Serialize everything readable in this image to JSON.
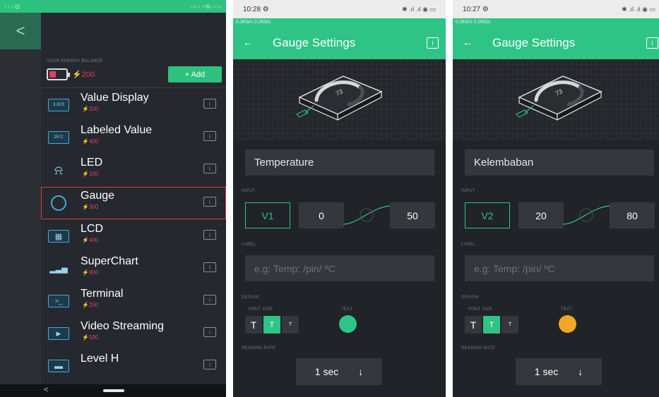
{
  "panel1": {
    "status_left": "◦ ◦ ◦  ⊡",
    "status_right": "◦◦◦ ◦ ◦◦%  ◦◦:◦◦",
    "back": "<",
    "balance_label": "YOUR ENERGY BALANCE",
    "balance": "200",
    "add_label": "+ Add",
    "items": [
      {
        "name": "Value Display",
        "cost": "200",
        "icon": "value-display-icon",
        "glyph": "3.3V3"
      },
      {
        "name": "Labeled Value",
        "cost": "400",
        "icon": "labeled-value-icon",
        "glyph": "25°C"
      },
      {
        "name": "LED",
        "cost": "100",
        "icon": "led-icon",
        "glyph": "⍾"
      },
      {
        "name": "Gauge",
        "cost": "300",
        "icon": "gauge-icon",
        "glyph": "◔"
      },
      {
        "name": "LCD",
        "cost": "400",
        "icon": "lcd-icon",
        "glyph": "▦"
      },
      {
        "name": "SuperChart",
        "cost": "900",
        "icon": "superchart-icon",
        "glyph": "▂▃▅"
      },
      {
        "name": "Terminal",
        "cost": "200",
        "icon": "terminal-icon",
        "glyph": ">_"
      },
      {
        "name": "Video Streaming",
        "cost": "500",
        "icon": "video-icon",
        "glyph": "▶"
      },
      {
        "name": "Level H",
        "cost": "",
        "icon": "level-h-icon",
        "glyph": "▬"
      }
    ],
    "info_glyph": "i",
    "nav_back": "<"
  },
  "panel2": {
    "time": "10:28 ⚙",
    "status_icons": "✱ .ıl .ıl ◉ ▭",
    "speed": "0.3Kb/s    0.2Kb/s",
    "back_arrow": "←",
    "title": "Gauge Settings",
    "info": "i",
    "name": "Temperature",
    "input_label": "INPUT",
    "pin": "V1",
    "min": "0",
    "max": "50",
    "label_label": "LABEL",
    "label_placeholder": "e.g: Temp: /pin/ ºC",
    "design_label": "DESIGN",
    "font_size_label": "FONT SIZE",
    "text_label": "TEXT",
    "fs_big": "T",
    "fs_mid": "T",
    "fs_small": "T",
    "color": "#2ec486",
    "reading_rate_label": "READING RATE",
    "rate": "1 sec",
    "rate_arrow": "↓",
    "gauge_value": "73"
  },
  "panel3": {
    "time": "10:27 ⚙",
    "status_icons": "✱ .ıl .ıl ◉ ▭",
    "speed": "0.0Kb/s    0.0Kb/s",
    "back_arrow": "←",
    "title": "Gauge Settings",
    "info": "i",
    "name": "Kelembaban",
    "input_label": "INPUT",
    "pin": "V2",
    "min": "20",
    "max": "80",
    "label_label": "LABEL",
    "label_placeholder": "e.g: Temp: /pin/ ºC",
    "design_label": "DESIGN",
    "font_size_label": "FONT SIZE",
    "text_label": "TEXT",
    "fs_big": "T",
    "fs_mid": "T",
    "fs_small": "T",
    "color": "#f5a623",
    "reading_rate_label": "READING RATE",
    "rate": "1 sec",
    "rate_arrow": "↓",
    "gauge_value": "73"
  }
}
